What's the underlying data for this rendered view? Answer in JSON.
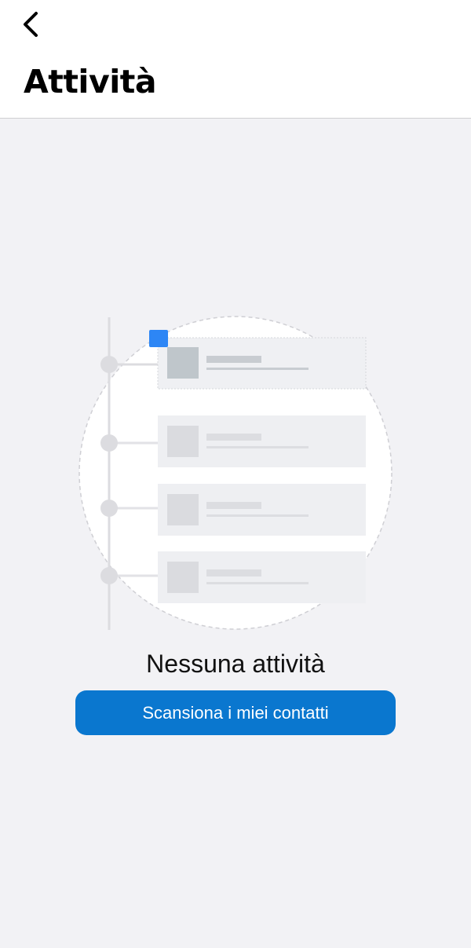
{
  "header": {
    "back_icon": "chevron-left-icon",
    "title": "Attività"
  },
  "empty_state": {
    "illustration": "activity-timeline-illustration",
    "title": "Nessuna attività",
    "button_label": "Scansiona i miei contatti"
  },
  "colors": {
    "accent": "#0a77cf",
    "highlight": "#2d86f5",
    "background": "#f2f2f5"
  }
}
